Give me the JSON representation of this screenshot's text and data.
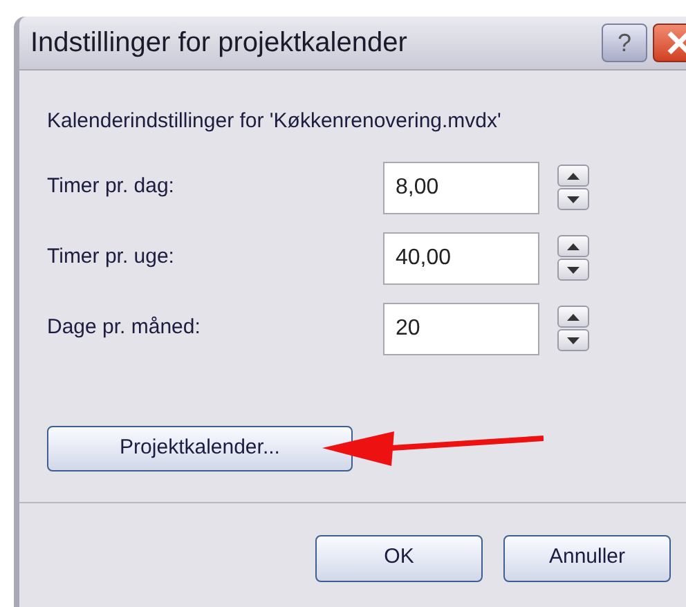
{
  "window": {
    "title": "Indstillinger for projektkalender",
    "help_button": "?"
  },
  "heading": "Kalenderindstillinger for 'Køkkenrenovering.mvdx'",
  "fields": [
    {
      "label": "Timer pr. dag:",
      "value": "8,00"
    },
    {
      "label": "Timer pr. uge:",
      "value": "40,00"
    },
    {
      "label": "Dage pr. måned:",
      "value": "20"
    }
  ],
  "calendar_button": "Projektkalender...",
  "buttons": [
    "OK",
    "Annuller"
  ]
}
